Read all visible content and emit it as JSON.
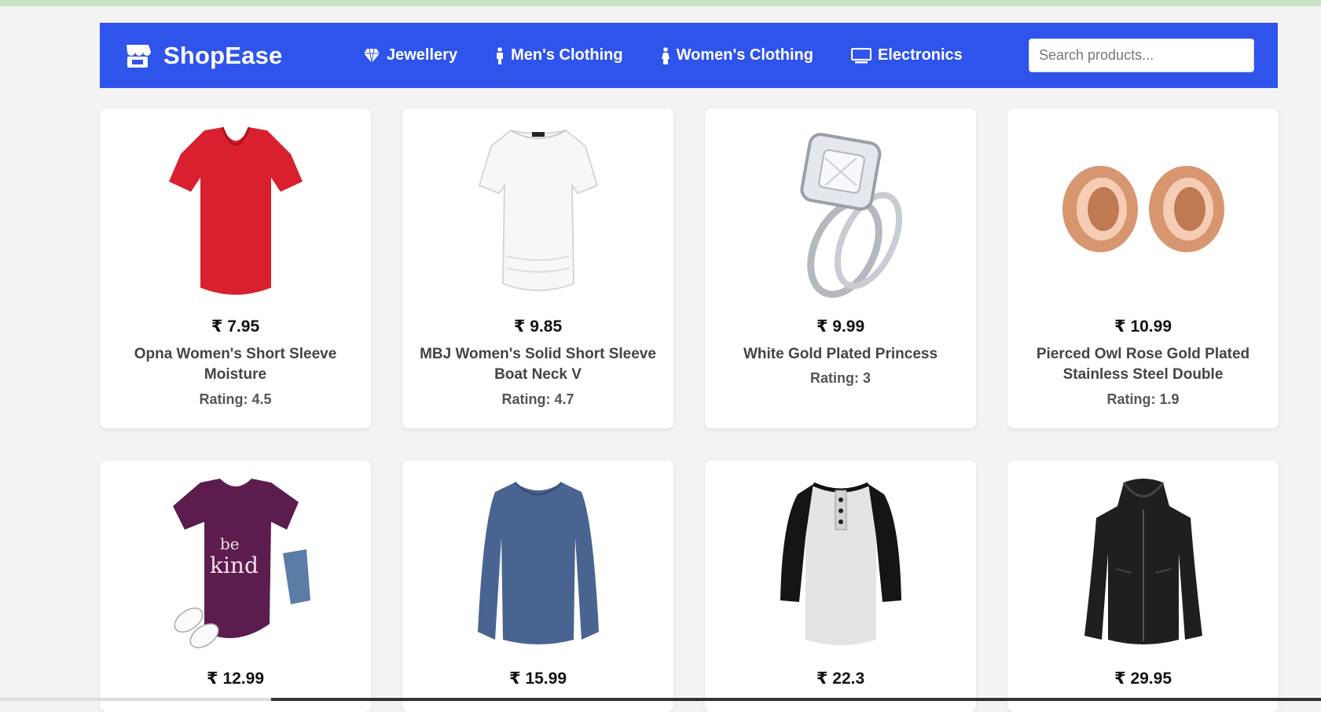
{
  "brand": {
    "name": "ShopEase"
  },
  "nav": [
    {
      "label": "Jewellery",
      "icon": "diamond-icon"
    },
    {
      "label": "Men's Clothing",
      "icon": "male-icon"
    },
    {
      "label": "Women's Clothing",
      "icon": "female-icon"
    },
    {
      "label": "Electronics",
      "icon": "desktop-icon"
    }
  ],
  "search": {
    "placeholder": "Search products...",
    "value": ""
  },
  "colors": {
    "navbar": "#2f54eb",
    "page": "#f3f3f3"
  },
  "products": [
    {
      "price": "₹ 7.95",
      "title": "Opna Women's Short Sleeve Moisture",
      "rating": "Rating: 4.5",
      "image": "red v-neck t-shirt"
    },
    {
      "price": "₹ 9.85",
      "title": "MBJ Women's Solid Short Sleeve Boat Neck V",
      "rating": "Rating: 4.7",
      "image": "white short sleeve top"
    },
    {
      "price": "₹ 9.99",
      "title": "White Gold Plated Princess",
      "rating": "Rating: 3",
      "image": "silver princess ring set"
    },
    {
      "price": "₹ 10.99",
      "title": "Pierced Owl Rose Gold Plated Stainless Steel Double",
      "rating": "Rating: 1.9",
      "image": "rose gold plugs"
    },
    {
      "price": "₹ 12.99",
      "title": "",
      "rating": "",
      "image": "purple be kind t-shirt"
    },
    {
      "price": "₹ 15.99",
      "title": "",
      "rating": "",
      "image": "blue long sleeve shirt"
    },
    {
      "price": "₹ 22.3",
      "title": "",
      "rating": "",
      "image": "raglan henley shirt"
    },
    {
      "price": "₹ 29.95",
      "title": "",
      "rating": "",
      "image": "black leather jacket"
    }
  ]
}
